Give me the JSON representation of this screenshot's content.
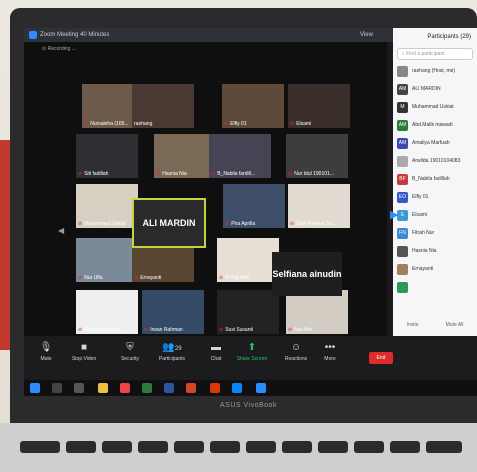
{
  "window": {
    "title": "Zoom Meeting 40 Minutes",
    "view_label": "View",
    "recording": "⊙ Recording ..."
  },
  "gallery": [
    {
      "name": "Nursaleha (165...",
      "muted": true,
      "bg": "#6d5a4a"
    },
    {
      "name": "raehang",
      "muted": false,
      "bg": "#4a3a33"
    },
    {
      "name": "Elfly 01",
      "muted": true,
      "bg": "#5d4a3a"
    },
    {
      "name": "Elsami",
      "muted": true,
      "bg": "#3a2f2a"
    },
    {
      "name": "Siti fadillah",
      "muted": true,
      "bg": "#2f2f33"
    },
    {
      "name": "Hasnia Nia",
      "muted": true,
      "bg": "#7a6a55"
    },
    {
      "name": "B_Nabila fardill...",
      "muted": true,
      "bg": "#445"
    },
    {
      "name": "Nur Idul 190101...",
      "muted": true,
      "bg": "#3d3d40"
    },
    {
      "name": "Muhammad Uskiat",
      "muted": true,
      "bg": "#d8d0c2"
    },
    {
      "name": "Pira Aprilla",
      "muted": true,
      "bg": "#3f4f6a"
    },
    {
      "name": "Opin Rahma Sa...",
      "muted": true,
      "bg": "#e0dad0"
    },
    {
      "name": "Nur Ulfa",
      "muted": true,
      "bg": "#7a8a99"
    },
    {
      "name": "Ernayanti",
      "muted": true,
      "bg": "#5a4533"
    },
    {
      "name": "M.Hajulfah",
      "muted": true,
      "bg": "#e5dfd6"
    },
    {
      "name": "Abd Majid maw...",
      "muted": true,
      "bg": "#eee"
    },
    {
      "name": "Irwan Rahman",
      "muted": true,
      "bg": "#344a66"
    },
    {
      "name": "Susi Susanti",
      "muted": true,
      "bg": "#222"
    },
    {
      "name": "Nur Aini",
      "muted": true,
      "bg": "#d3ccc2"
    }
  ],
  "name_tiles": {
    "active_speaker": "ALI MARDIN",
    "other": "Selfiana ainudin"
  },
  "toolbar": {
    "mute": "Mute",
    "stop_video": "Stop Video",
    "security": "Security",
    "participants": "Participants",
    "participants_count": "29",
    "chat": "Chat",
    "share": "Share Screen",
    "reactions": "Reactions",
    "more": "More",
    "end": "End"
  },
  "participants_panel": {
    "header": "Participants (29)",
    "search_placeholder": "Find a participant",
    "items": [
      {
        "name": "raehang (Host, me)",
        "initials": "",
        "color": "#888"
      },
      {
        "name": "ALI MARDIN",
        "initials": "AM",
        "color": "#444"
      },
      {
        "name": "Muhammad Uskiat",
        "initials": "M",
        "color": "#333"
      },
      {
        "name": "Abd.Malik mawadi",
        "initials": "AM",
        "color": "#2a7d3c"
      },
      {
        "name": "Amaliya Marfuah",
        "initials": "AM",
        "color": "#3b4bb3"
      },
      {
        "name": "Arwilda 19010104083",
        "initials": "",
        "color": "#aaa"
      },
      {
        "name": "B_Nabila fadillah",
        "initials": "BF",
        "color": "#c43c3c"
      },
      {
        "name": "Elfly 01",
        "initials": "EO",
        "color": "#3558c4"
      },
      {
        "name": "Elsami",
        "initials": "E",
        "color": "#3a9bd4"
      },
      {
        "name": "Fitrah Nur",
        "initials": "FN",
        "color": "#3a8ad0"
      },
      {
        "name": "Hasnia Nia",
        "initials": "",
        "color": "#555"
      },
      {
        "name": "Ernayanti",
        "initials": "",
        "color": "#a08060"
      },
      {
        "name": "",
        "initials": "",
        "color": "#2a9a55"
      }
    ],
    "footer_left": "Invite",
    "footer_right": "Mute All"
  },
  "laptop_brand": "ASUS VivoBook",
  "colors": {
    "zoom_blue": "#2d8cff",
    "end_red": "#e02b2b",
    "active_border": "#c7d23c",
    "share_green": "#21c55d"
  }
}
